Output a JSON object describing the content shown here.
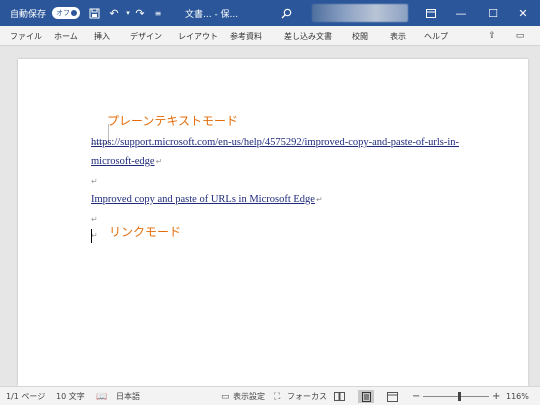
{
  "titlebar": {
    "autosave_label": "自動保存",
    "autosave_state": "オフ",
    "doc_title": "文書... - 保...",
    "icons": [
      "save-icon",
      "undo-icon",
      "redo-icon",
      "customize-qat-icon",
      "search-icon",
      "ribbon-display-icon",
      "minimize-icon",
      "maximize-icon",
      "close-icon"
    ],
    "bg_color": "#2b579a"
  },
  "ribbon": {
    "tabs": [
      "ファイル",
      "ホーム",
      "挿入",
      "デザイン",
      "レイアウト",
      "参考資料",
      "差し込み文書",
      "校閲",
      "表示",
      "ヘルプ"
    ]
  },
  "document": {
    "heading1": "プレーンテキストモード",
    "url_text": "https://support.microsoft.com/en-us/help/4575292/improved-copy-and-paste-of-urls-in-",
    "url_text_cont": "microsoft-edge",
    "link_title": "Improved copy and paste of URLs in Microsoft Edge",
    "heading2": "リンクモード",
    "paragraph_mark": "↵",
    "heading_color": "#e36c09"
  },
  "statusbar": {
    "page": "1/1 ページ",
    "words": "10 文字",
    "language": "日本語",
    "display_settings": "表示設定",
    "focus": "フォーカス",
    "zoom_minus": "−",
    "zoom_plus": "+",
    "zoom_level": "116%",
    "zoom_fraction": 0.55
  }
}
